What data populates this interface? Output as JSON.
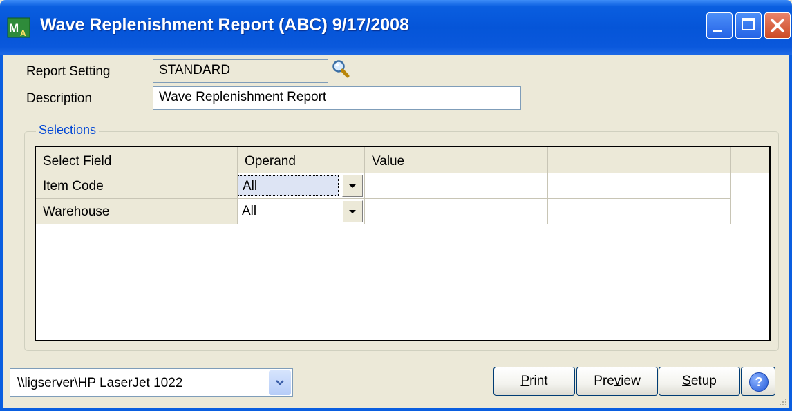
{
  "window": {
    "title": "Wave Replenishment Report (ABC) 9/17/2008",
    "icon": "mas-app-icon"
  },
  "form": {
    "report_setting_label": "Report Setting",
    "report_setting_value": "STANDARD",
    "description_label": "Description",
    "description_value": "Wave Replenishment Report"
  },
  "selections": {
    "legend": "Selections",
    "columns": [
      "Select Field",
      "Operand",
      "Value",
      ""
    ],
    "rows": [
      {
        "field": "Item Code",
        "operand": "All",
        "value": "",
        "extra": ""
      },
      {
        "field": "Warehouse",
        "operand": "All",
        "value": "",
        "extra": ""
      }
    ]
  },
  "printer": {
    "value": "\\\\ligserver\\HP LaserJet 1022"
  },
  "buttons": {
    "print": {
      "pre": "",
      "u": "P",
      "post": "rint"
    },
    "preview": {
      "pre": "Pre",
      "u": "v",
      "post": "iew"
    },
    "setup": {
      "pre": "",
      "u": "S",
      "post": "etup"
    },
    "help": "?"
  }
}
